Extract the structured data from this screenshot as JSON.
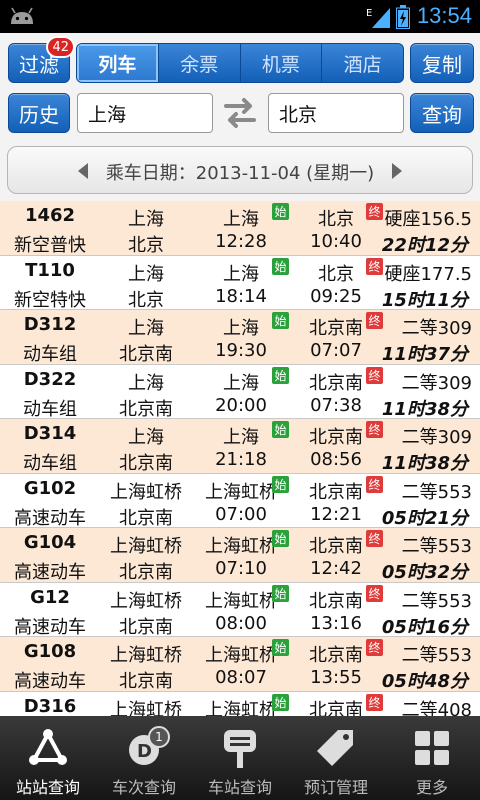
{
  "statusbar": {
    "time": "13:54",
    "network": "E"
  },
  "toolbar": {
    "filter_label": "过滤",
    "filter_badge": "42",
    "tabs": [
      {
        "label": "列车",
        "active": true
      },
      {
        "label": "余票",
        "active": false
      },
      {
        "label": "机票",
        "active": false
      },
      {
        "label": "酒店",
        "active": false
      }
    ],
    "copy_label": "复制",
    "history_label": "历史",
    "query_label": "查询",
    "from_station": "上海",
    "to_station": "北京"
  },
  "date": {
    "text": "乘车日期：2013-11-04 (星期一)"
  },
  "marks": {
    "start": "始",
    "end": "终"
  },
  "trains": [
    {
      "no": "1462",
      "type": "新空普快",
      "from": "上海",
      "to": "北京",
      "board": "上海",
      "dep": "12:28",
      "alight": "北京",
      "arr": "10:40",
      "seat": "硬座156.5",
      "duration": "22时12分"
    },
    {
      "no": "T110",
      "type": "新空特快",
      "from": "上海",
      "to": "北京",
      "board": "上海",
      "dep": "18:14",
      "alight": "北京",
      "arr": "09:25",
      "seat": "硬座177.5",
      "duration": "15时11分"
    },
    {
      "no": "D312",
      "type": "动车组",
      "from": "上海",
      "to": "北京南",
      "board": "上海",
      "dep": "19:30",
      "alight": "北京南",
      "arr": "07:07",
      "seat": "二等309",
      "duration": "11时37分"
    },
    {
      "no": "D322",
      "type": "动车组",
      "from": "上海",
      "to": "北京南",
      "board": "上海",
      "dep": "20:00",
      "alight": "北京南",
      "arr": "07:38",
      "seat": "二等309",
      "duration": "11时38分"
    },
    {
      "no": "D314",
      "type": "动车组",
      "from": "上海",
      "to": "北京南",
      "board": "上海",
      "dep": "21:18",
      "alight": "北京南",
      "arr": "08:56",
      "seat": "二等309",
      "duration": "11时38分"
    },
    {
      "no": "G102",
      "type": "高速动车",
      "from": "上海虹桥",
      "to": "北京南",
      "board": "上海虹桥",
      "dep": "07:00",
      "alight": "北京南",
      "arr": "12:21",
      "seat": "二等553",
      "duration": "05时21分"
    },
    {
      "no": "G104",
      "type": "高速动车",
      "from": "上海虹桥",
      "to": "北京南",
      "board": "上海虹桥",
      "dep": "07:10",
      "alight": "北京南",
      "arr": "12:42",
      "seat": "二等553",
      "duration": "05时32分"
    },
    {
      "no": "G12",
      "type": "高速动车",
      "from": "上海虹桥",
      "to": "北京南",
      "board": "上海虹桥",
      "dep": "08:00",
      "alight": "北京南",
      "arr": "13:16",
      "seat": "二等553",
      "duration": "05时16分"
    },
    {
      "no": "G108",
      "type": "高速动车",
      "from": "上海虹桥",
      "to": "北京南",
      "board": "上海虹桥",
      "dep": "08:07",
      "alight": "北京南",
      "arr": "13:55",
      "seat": "二等553",
      "duration": "05时48分"
    },
    {
      "no": "D316",
      "type": "",
      "from": "上海虹桥",
      "to": "",
      "board": "上海虹桥",
      "dep": "",
      "alight": "北京南",
      "arr": "",
      "seat": "二等408",
      "duration": ""
    }
  ],
  "bottomnav": {
    "items": [
      {
        "label": "站站查询",
        "icon": "station-route-icon",
        "active": true
      },
      {
        "label": "车次查询",
        "icon": "train-number-icon",
        "badge": "1",
        "active": false
      },
      {
        "label": "车站查询",
        "icon": "station-sign-icon",
        "active": false
      },
      {
        "label": "预订管理",
        "icon": "ticket-tag-icon",
        "active": false
      },
      {
        "label": "更多",
        "icon": "grid-more-icon",
        "active": false
      }
    ]
  }
}
